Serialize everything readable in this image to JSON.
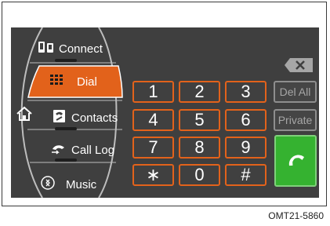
{
  "menu": {
    "items": [
      {
        "label": "Connect",
        "icon": "phone-connect-icon"
      },
      {
        "label": "Dial",
        "icon": "keypad-icon"
      },
      {
        "label": "Contacts",
        "icon": "contacts-icon"
      },
      {
        "label": "Call Log",
        "icon": "call-log-icon"
      },
      {
        "label": "Music",
        "icon": "music-icon"
      }
    ],
    "active": "Dial",
    "home_icon": "home-icon"
  },
  "keypad": {
    "keys": [
      "1",
      "2",
      "3",
      "4",
      "5",
      "6",
      "7",
      "8",
      "9",
      "∗",
      "0",
      "#"
    ]
  },
  "actions": {
    "delete_all": "Del All",
    "private": "Private",
    "backspace_icon": "backspace-icon",
    "call_icon": "handset-icon"
  },
  "colors": {
    "active_tab": "#e2621b",
    "key_border": "#e2621b",
    "call_button": "#35b230",
    "screen_bg": "#3f3f3f"
  },
  "caption": "OMT21-5860"
}
